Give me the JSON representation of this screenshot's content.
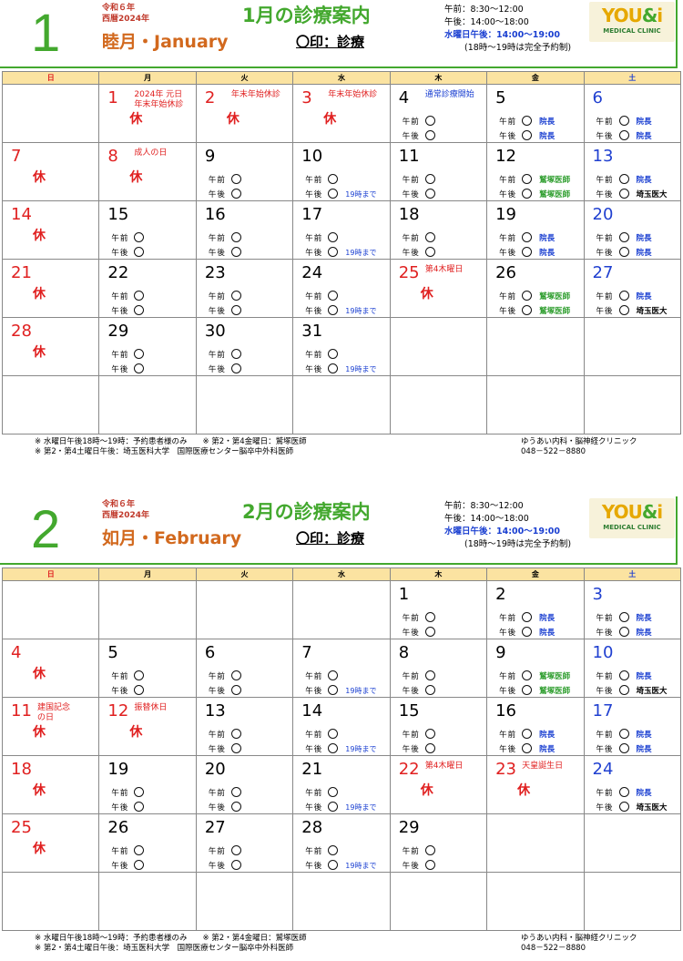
{
  "common": {
    "weekday_headers": [
      "日",
      "月",
      "火",
      "水",
      "木",
      "金",
      "土"
    ],
    "mark_text": "〇印：診療",
    "hours": {
      "am": "午前：8:30〜12:00",
      "pm": "午後：14:00〜18:00",
      "wed": "水曜日午後：14:00〜19:00",
      "note": "(18時〜19時は完全予約制)"
    },
    "logo": {
      "you": "YOU",
      "amp": "&",
      "i": "i",
      "sub": "MEDICAL CLINIC"
    },
    "label_am": "午前",
    "label_pm": "午後",
    "kyu": "休",
    "footer": {
      "line1": "※ 水曜日午後18時〜19時：予約患者様のみ　　※ 第2・第4金曜日：鷲塚医師",
      "line2": "※ 第2・第4土曜日午後：埼玉医科大学　国際医療センター脳卒中外科医師",
      "clinic": "ゆうあい内科・脳神経クリニック",
      "phone": "048－522－8880"
    },
    "colors": {
      "green": "#43a82e",
      "orange": "#d2691e",
      "red": "#e02020",
      "blue": "#2040d0",
      "header_bg": "#fbe3a1"
    }
  },
  "months": [
    {
      "number": "1",
      "reiwa": "令和６年",
      "seireki": "西暦2024年",
      "name": "睦月・January",
      "title": "1月の診療案内",
      "weeks": [
        [
          null,
          {
            "d": "1",
            "c": "red",
            "note": "2024年 元日\n年末年始休診",
            "kyu": true
          },
          {
            "d": "2",
            "c": "red",
            "note": "年末年始休診",
            "kyu": true
          },
          {
            "d": "3",
            "c": "red",
            "note": "年末年始休診",
            "kyu": true
          },
          {
            "d": "4",
            "note": "通常診療開始",
            "nc": "blue",
            "am": "",
            "pm": ""
          },
          {
            "d": "5",
            "am": "院長",
            "pm": "院長"
          },
          {
            "d": "6",
            "c": "blue",
            "am": "院長",
            "pm": "院長"
          }
        ],
        [
          {
            "d": "7",
            "c": "red",
            "kyu": true
          },
          {
            "d": "8",
            "c": "red",
            "note": "成人の日",
            "kyu": true
          },
          {
            "d": "9",
            "am": "",
            "pm": ""
          },
          {
            "d": "10",
            "am": "",
            "pm": "19時まで"
          },
          {
            "d": "11",
            "am": "",
            "pm": ""
          },
          {
            "d": "12",
            "am": "鷲塚医師",
            "pm": "鷲塚医師"
          },
          {
            "d": "13",
            "c": "blue",
            "am": "院長",
            "pm": "埼玉医大"
          }
        ],
        [
          {
            "d": "14",
            "c": "red",
            "kyu": true
          },
          {
            "d": "15",
            "am": "",
            "pm": ""
          },
          {
            "d": "16",
            "am": "",
            "pm": ""
          },
          {
            "d": "17",
            "am": "",
            "pm": "19時まで"
          },
          {
            "d": "18",
            "am": "",
            "pm": ""
          },
          {
            "d": "19",
            "am": "院長",
            "pm": "院長"
          },
          {
            "d": "20",
            "c": "blue",
            "am": "院長",
            "pm": "院長"
          }
        ],
        [
          {
            "d": "21",
            "c": "red",
            "kyu": true
          },
          {
            "d": "22",
            "am": "",
            "pm": ""
          },
          {
            "d": "23",
            "am": "",
            "pm": ""
          },
          {
            "d": "24",
            "am": "",
            "pm": "19時まで"
          },
          {
            "d": "25",
            "c": "red",
            "note": "第4木曜日",
            "kyu": true
          },
          {
            "d": "26",
            "am": "鷲塚医師",
            "pm": "鷲塚医師"
          },
          {
            "d": "27",
            "c": "blue",
            "am": "院長",
            "pm": "埼玉医大"
          }
        ],
        [
          {
            "d": "28",
            "c": "red",
            "kyu": true
          },
          {
            "d": "29",
            "am": "",
            "pm": ""
          },
          {
            "d": "30",
            "am": "",
            "pm": ""
          },
          {
            "d": "31",
            "am": "",
            "pm": "19時まで"
          },
          null,
          null,
          null
        ],
        [
          null,
          null,
          null,
          null,
          null,
          null,
          null
        ]
      ]
    },
    {
      "number": "2",
      "reiwa": "令和６年",
      "seireki": "西暦2024年",
      "name": "如月・February",
      "title": "2月の診療案内",
      "weeks": [
        [
          null,
          null,
          null,
          null,
          {
            "d": "1",
            "am": "",
            "pm": ""
          },
          {
            "d": "2",
            "am": "院長",
            "pm": "院長"
          },
          {
            "d": "3",
            "c": "blue",
            "am": "院長",
            "pm": "院長"
          }
        ],
        [
          {
            "d": "4",
            "c": "red",
            "kyu": true
          },
          {
            "d": "5",
            "am": "",
            "pm": ""
          },
          {
            "d": "6",
            "am": "",
            "pm": ""
          },
          {
            "d": "7",
            "am": "",
            "pm": "19時まで"
          },
          {
            "d": "8",
            "am": "",
            "pm": ""
          },
          {
            "d": "9",
            "am": "鷲塚医師",
            "pm": "鷲塚医師"
          },
          {
            "d": "10",
            "c": "blue",
            "am": "院長",
            "pm": "埼玉医大"
          }
        ],
        [
          {
            "d": "11",
            "c": "red",
            "note": "建国記念\nの日",
            "kyu": true
          },
          {
            "d": "12",
            "c": "red",
            "note": "振替休日",
            "kyu": true
          },
          {
            "d": "13",
            "am": "",
            "pm": ""
          },
          {
            "d": "14",
            "am": "",
            "pm": "19時まで"
          },
          {
            "d": "15",
            "am": "",
            "pm": ""
          },
          {
            "d": "16",
            "am": "院長",
            "pm": "院長"
          },
          {
            "d": "17",
            "c": "blue",
            "am": "院長",
            "pm": "院長"
          }
        ],
        [
          {
            "d": "18",
            "c": "red",
            "kyu": true
          },
          {
            "d": "19",
            "am": "",
            "pm": ""
          },
          {
            "d": "20",
            "am": "",
            "pm": ""
          },
          {
            "d": "21",
            "am": "",
            "pm": "19時まで"
          },
          {
            "d": "22",
            "c": "red",
            "note": "第4木曜日",
            "kyu": true
          },
          {
            "d": "23",
            "c": "red",
            "note": "天皇誕生日",
            "kyu": true
          },
          {
            "d": "24",
            "c": "blue",
            "am": "院長",
            "pm": "埼玉医大"
          }
        ],
        [
          {
            "d": "25",
            "c": "red",
            "kyu": true
          },
          {
            "d": "26",
            "am": "",
            "pm": ""
          },
          {
            "d": "27",
            "am": "",
            "pm": ""
          },
          {
            "d": "28",
            "am": "",
            "pm": "19時まで"
          },
          {
            "d": "29",
            "am": "",
            "pm": ""
          },
          null,
          null
        ],
        [
          null,
          null,
          null,
          null,
          null,
          null,
          null
        ]
      ]
    }
  ]
}
